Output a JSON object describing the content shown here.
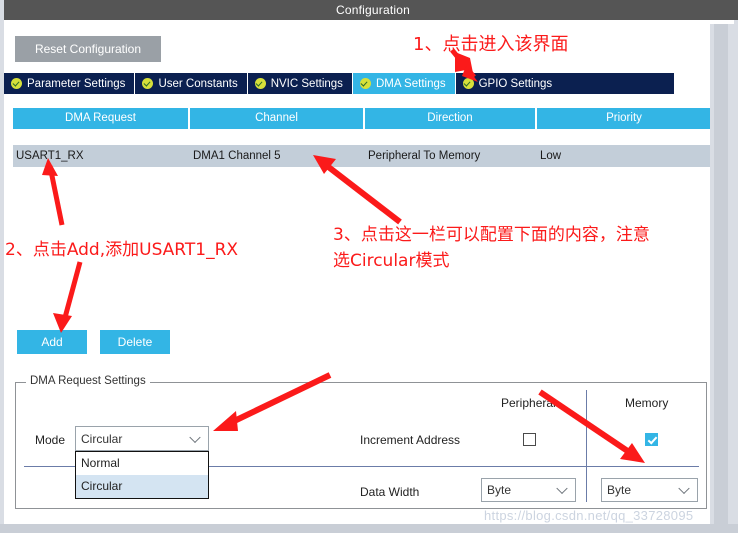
{
  "window": {
    "title": "Configuration"
  },
  "toolbar": {
    "reset_label": "Reset Configuration"
  },
  "tabs": [
    {
      "label": "Parameter Settings",
      "icon": "check-circle-icon",
      "active": false
    },
    {
      "label": "User Constants",
      "icon": "check-circle-icon",
      "active": false
    },
    {
      "label": "NVIC Settings",
      "icon": "check-circle-icon",
      "active": false
    },
    {
      "label": "DMA Settings",
      "icon": "check-circle-icon",
      "active": true
    },
    {
      "label": "GPIO Settings",
      "icon": "check-circle-icon",
      "active": false
    }
  ],
  "table": {
    "columns": [
      "DMA Request",
      "Channel",
      "Direction",
      "Priority"
    ],
    "rows": [
      {
        "dma_request": "USART1_RX",
        "channel": "DMA1 Channel 5",
        "direction": "Peripheral To Memory",
        "priority": "Low"
      }
    ]
  },
  "buttons": {
    "add_label": "Add",
    "delete_label": "Delete"
  },
  "request_settings": {
    "legend": "DMA Request Settings",
    "mode_label": "Mode",
    "mode_value": "Circular",
    "mode_options": [
      "Normal",
      "Circular"
    ],
    "mode_selected_option": "Circular",
    "peripheral_header": "Peripheral",
    "memory_header": "Memory",
    "increment_address_label": "Increment Address",
    "increment_peripheral_checked": "false",
    "increment_memory_checked": "true",
    "data_width_label": "Data Width",
    "data_width_peripheral": "Byte",
    "data_width_memory": "Byte"
  },
  "annotations": {
    "note1": "1、点击进入该界面",
    "note2": "2、点击Add,添加USART1_RX",
    "note3": "3、点击这一栏可以配置下面的内容，注意\n选Circular模式",
    "color": "#fb1a1a"
  },
  "watermark": {
    "text": "https://blog.csdn.net/qq_33728095"
  },
  "colors": {
    "accent": "#33b5e5",
    "tabbar": "#0b2050",
    "titlebar": "#555555",
    "row": "#c3ced9",
    "annotation_red": "#fb1a1a"
  }
}
